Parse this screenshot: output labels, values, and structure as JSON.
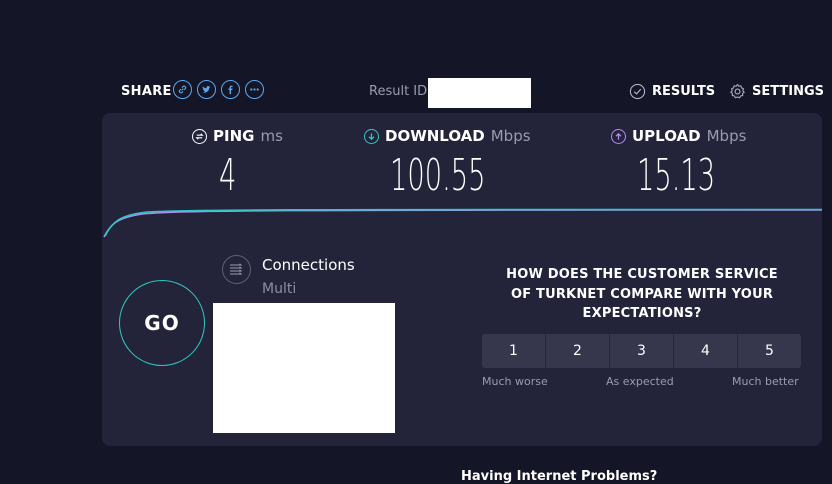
{
  "header": {
    "share_label": "SHARE",
    "share_icons": [
      "link-icon",
      "twitter-icon",
      "facebook-icon",
      "more-icon"
    ],
    "result_label": "Result ID",
    "results_label": "RESULTS",
    "settings_label": "SETTINGS"
  },
  "metrics": {
    "ping": {
      "label": "PING",
      "unit": "ms",
      "value": "4"
    },
    "download": {
      "label": "DOWNLOAD",
      "unit": "Mbps",
      "value": "100.55"
    },
    "upload": {
      "label": "UPLOAD",
      "unit": "Mbps",
      "value": "15.13"
    }
  },
  "connection": {
    "title": "Connections",
    "mode": "Multi"
  },
  "go_label": "GO",
  "survey": {
    "question": "HOW DOES THE CUSTOMER SERVICE OF TURKNET COMPARE WITH YOUR EXPECTATIONS?",
    "options": [
      "1",
      "2",
      "3",
      "4",
      "5"
    ],
    "low_label": "Much worse",
    "mid_label": "As expected",
    "high_label": "Much better"
  },
  "footer": {
    "help_text": "Having Internet Problems?"
  },
  "colors": {
    "background": "#141526",
    "panel": "#232439",
    "ping_accent": "#ffffff",
    "download_accent": "#2fc8c4",
    "upload_accent": "#b58bf0"
  }
}
